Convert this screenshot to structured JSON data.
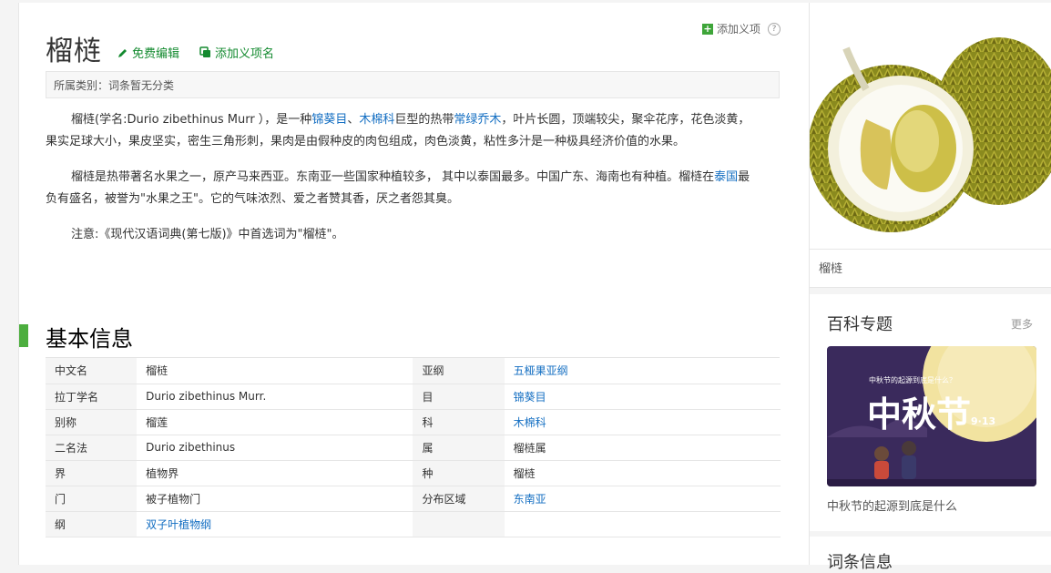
{
  "entry": {
    "title": "榴梿",
    "edit_label": "免费编辑",
    "add_sense_label": "添加义项名",
    "add_item_label": "添加义项",
    "help_label": "?",
    "category": "所属类别：词条暂无分类"
  },
  "summary": {
    "p1": {
      "t1": "榴梿(学名:Durio zibethinus Murr ），是一种",
      "l1": "锦葵目",
      "t2": "、",
      "l2": "木棉科",
      "t3": "巨型的热带",
      "l3": "常绿乔木",
      "t4": "，叶片长圆，顶端较尖，聚伞花序，花色淡黄，果实足球大小，果皮坚实，密生三角形刺，果肉是由假种皮的肉包组成，肉色淡黄，粘性多汁是一种极具经济价值的水果。"
    },
    "p2": {
      "t1": "榴梿是热带著名水果之一，原产马来西亚。东南亚一些国家种植较多， 其中以泰国最多。中国广东、海南也有种植。榴梿在",
      "l1": "泰国",
      "t2": "最负有盛名，被誉为\"水果之王\"。它的气味浓烈、爱之者赞其香，厌之者怨其臭。"
    },
    "p3": "注意:《现代汉语词典(第七版)》中首选词为\"榴梿\"。"
  },
  "basic_info": {
    "title": "基本信息",
    "left": [
      {
        "key": "中文名",
        "value": "榴梿",
        "link": false
      },
      {
        "key": "拉丁学名",
        "value": "Durio zibethinus Murr.",
        "link": false
      },
      {
        "key": "别称",
        "value": "榴莲",
        "link": false
      },
      {
        "key": "二名法",
        "value": "Durio zibethinus",
        "link": false
      },
      {
        "key": "界",
        "value": "植物界",
        "link": false
      },
      {
        "key": "门",
        "value": "被子植物门",
        "link": false
      },
      {
        "key": "纲",
        "value": "双子叶植物纲",
        "link": true
      }
    ],
    "right": [
      {
        "key": "亚纲",
        "value": "五桠果亚纲",
        "link": true
      },
      {
        "key": "目",
        "value": "锦葵目",
        "link": true
      },
      {
        "key": "科",
        "value": "木棉科",
        "link": true
      },
      {
        "key": "属",
        "value": "榴梿属",
        "link": false
      },
      {
        "key": "种",
        "value": "榴梿",
        "link": false
      },
      {
        "key": "分布区域",
        "value": "东南亚",
        "link": true
      }
    ]
  },
  "sidebar": {
    "image_caption": "榴梿",
    "topic_title": "百科专题",
    "more_label": "更多",
    "banner": {
      "small_text": "中秋节的起源到底是什么？",
      "big_text": "中秋节",
      "date_text": "9·13"
    },
    "banner_caption": "中秋节的起源到底是什么",
    "entry_info_title": "词条信息"
  },
  "colors": {
    "link_blue": "#136ec2",
    "edit_green": "#138a2f",
    "section_green": "#4cae3e",
    "banner_purple": "#3a2a5c"
  }
}
